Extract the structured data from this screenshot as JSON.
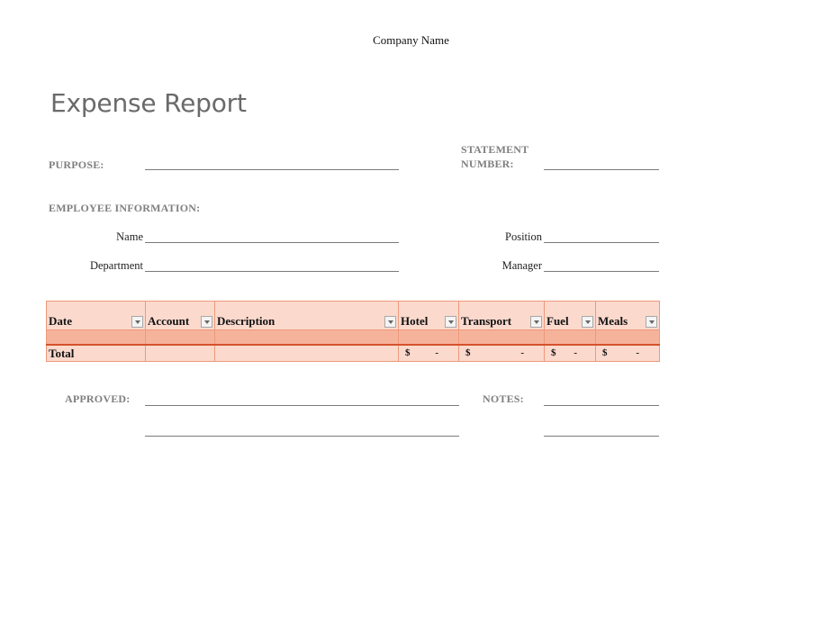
{
  "header": {
    "company_name": "Company Name",
    "title": "Expense Report"
  },
  "form": {
    "purpose_label": "PURPOSE:",
    "statement_label_line1": "STATEMENT",
    "statement_label_line2": "NUMBER:",
    "employee_info_label": "EMPLOYEE INFORMATION:",
    "name_label": "Name",
    "department_label": "Department",
    "position_label": "Position",
    "manager_label": "Manager",
    "purpose_value": "",
    "statement_value": "",
    "name_value": "",
    "department_value": "",
    "position_value": "",
    "manager_value": ""
  },
  "table": {
    "columns": [
      "Date",
      "Account",
      "Description",
      "Hotel",
      "Transport",
      "Fuel",
      "Meals"
    ],
    "rows": [
      [
        "",
        "",
        "",
        "",
        "",
        "",
        ""
      ]
    ],
    "total_label": "Total",
    "totals": {
      "hotel": {
        "currency": "$",
        "value": "-"
      },
      "transport": {
        "currency": "$",
        "value": "-"
      },
      "fuel": {
        "currency": "$",
        "value": "-"
      },
      "meals": {
        "currency": "$",
        "value": "-"
      }
    },
    "colors": {
      "header_bg": "#fbd9cd",
      "row_bg": "#f6b39c",
      "accent_line": "#d5512a",
      "border": "#ec9a7c"
    }
  },
  "footer": {
    "approved_label": "APPROVED:",
    "notes_label": "NOTES:"
  }
}
